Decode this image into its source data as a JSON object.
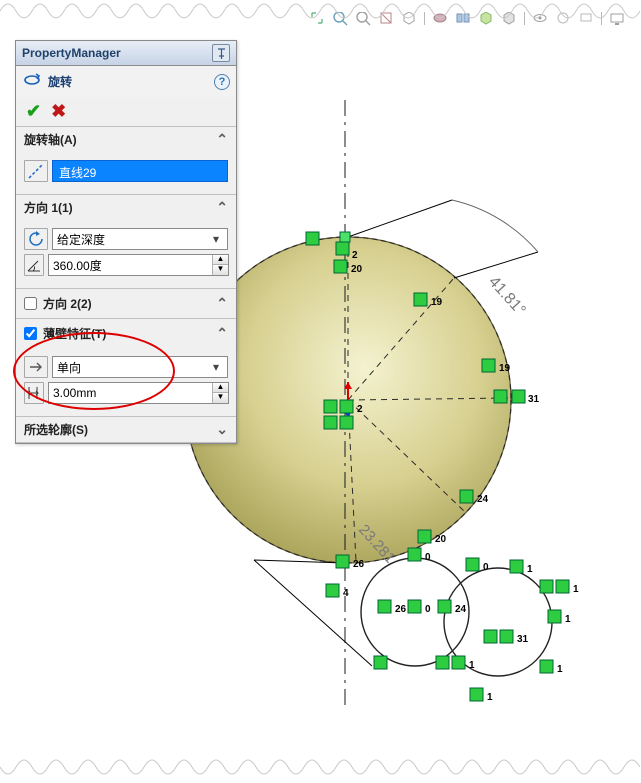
{
  "panel": {
    "title": "PropertyManager"
  },
  "feature": {
    "name": "旋转"
  },
  "sections": {
    "axis": {
      "title": "旋转轴(A)",
      "selection": "直线29"
    },
    "dir1": {
      "title": "方向 1(1)",
      "endcond": "给定深度",
      "angle": "360.00度"
    },
    "dir2": {
      "title": "方向 2(2)"
    },
    "thin": {
      "title": "薄壁特征(T)",
      "type": "单向",
      "thickness": "3.00mm"
    },
    "contour": {
      "title": "所选轮廓(S)"
    }
  },
  "sketch": {
    "angle_dim": "41.81°",
    "radial_dim": "23.281",
    "points": {
      "2a": "2",
      "20a": "20",
      "20b": "20",
      "19a": "19",
      "19b": "19",
      "31a": "31",
      "24a": "24",
      "0a": "0",
      "26a": "26",
      "4a": "4",
      "26b": "26",
      "0b": "0",
      "24b": "24",
      "0c": "0",
      "1a": "1",
      "1b": "1",
      "1c": "1",
      "31b": "31",
      "1d": "1",
      "1e": "1",
      "1f": "1",
      "2b": "2"
    }
  }
}
